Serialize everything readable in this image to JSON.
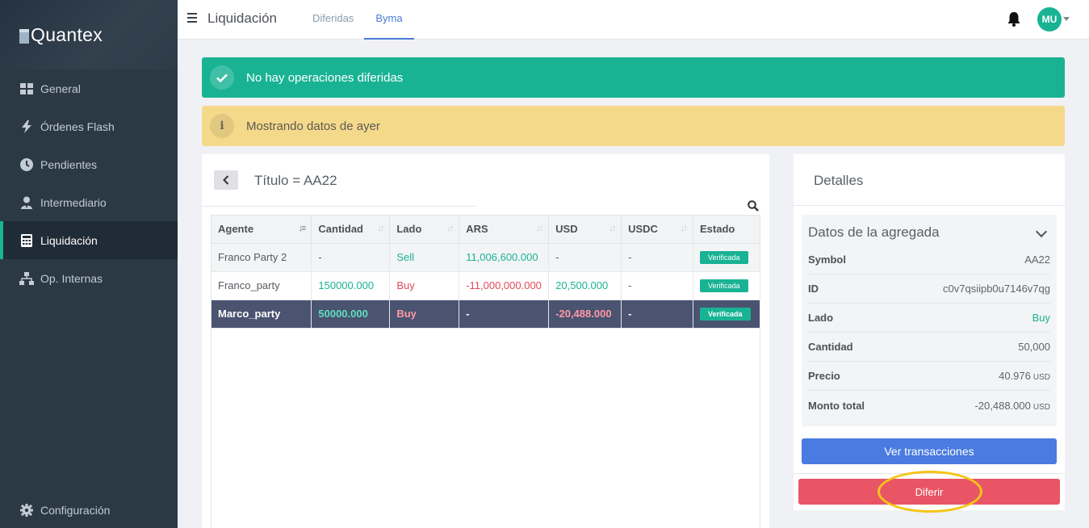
{
  "app": {
    "logo_text": "Quantex"
  },
  "sidebar": {
    "items": [
      {
        "label": "General",
        "icon": "grid-icon"
      },
      {
        "label": "Órdenes Flash",
        "icon": "bolt-icon"
      },
      {
        "label": "Pendientes",
        "icon": "clock-icon"
      },
      {
        "label": "Intermediario",
        "icon": "user-tie-icon"
      },
      {
        "label": "Liquidación",
        "icon": "calculator-icon",
        "active": true
      },
      {
        "label": "Op. Internas",
        "icon": "network-icon"
      }
    ],
    "settings_label": "Configuración"
  },
  "header": {
    "title": "Liquidación",
    "tabs": [
      {
        "label": "Diferidas",
        "active": false
      },
      {
        "label": "Byma",
        "active": true
      }
    ],
    "avatar_initials": "MU"
  },
  "alerts": {
    "success": "No hay operaciones diferidas",
    "warning": "Mostrando datos de ayer",
    "warning_icon_glyph": "i"
  },
  "main": {
    "title": "Título = AA22",
    "table": {
      "columns": [
        "Agente",
        "Cantidad",
        "Lado",
        "ARS",
        "USD",
        "USDC",
        "Estado"
      ],
      "rows": [
        {
          "agente": "Franco Party 2",
          "cantidad": "-",
          "lado": "Sell",
          "ars": "11,006,600.000",
          "usd": "-",
          "usdc": "-",
          "estado": "Verificada"
        },
        {
          "agente": "Franco_party",
          "cantidad": "150000.000",
          "lado": "Buy",
          "ars": "-11,000,000.000",
          "usd": "20,500.000",
          "usdc": "-",
          "estado": "Verificada"
        },
        {
          "agente": "Marco_party",
          "cantidad": "50000.000",
          "lado": "Buy",
          "ars": "-",
          "usd": "-20,488.000",
          "usdc": "-",
          "estado": "Verificada"
        }
      ]
    }
  },
  "details": {
    "title": "Detalles",
    "aggregate_title": "Datos de la agregada",
    "fields": [
      {
        "label": "Symbol",
        "value": "AA22",
        "unit": ""
      },
      {
        "label": "ID",
        "value": "c0v7qsiipb0u7146v7qg",
        "unit": ""
      },
      {
        "label": "Lado",
        "value": "Buy",
        "unit": ""
      },
      {
        "label": "Cantidad",
        "value": "50,000",
        "unit": ""
      },
      {
        "label": "Precio",
        "value": "40.976",
        "unit": "USD"
      },
      {
        "label": "Monto total",
        "value": "-20,488.000",
        "unit": "USD"
      }
    ],
    "ver_button": "Ver transacciones",
    "diferir_button": "Diferir"
  },
  "colors": {
    "sidebar_bg": "#2b3945",
    "accent_green": "#19b394",
    "warning_bg": "#f5d98b",
    "primary_blue": "#4a7be0",
    "danger_red": "#ea5566",
    "selected_row": "#4a5370",
    "highlight_ring": "#f5c518"
  }
}
